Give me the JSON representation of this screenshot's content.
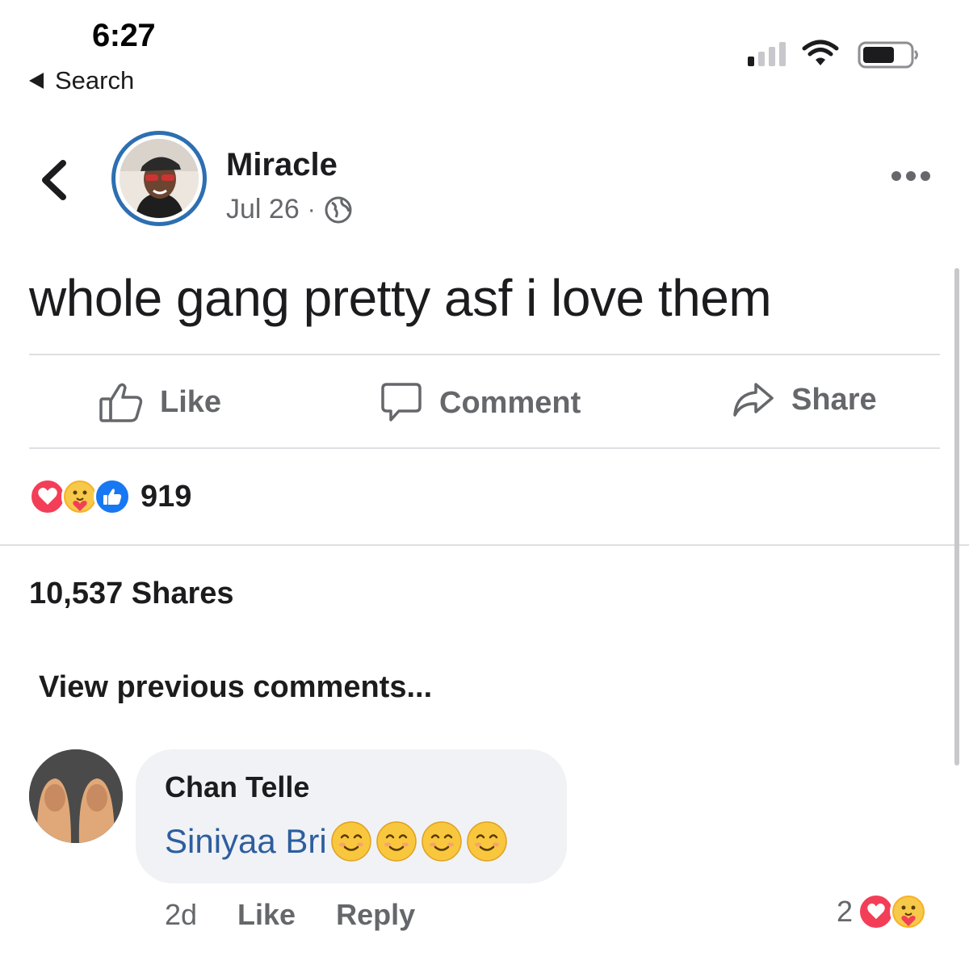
{
  "status_bar": {
    "time": "6:27",
    "back_label": "Search"
  },
  "post": {
    "author": "Miracle",
    "date": "Jul 26",
    "meta_separator": "·",
    "privacy_icon": "globe-icon",
    "text": "whole gang pretty asf i love them"
  },
  "actions": {
    "like": "Like",
    "comment": "Comment",
    "share": "Share"
  },
  "reactions": {
    "types": [
      "love",
      "care",
      "like"
    ],
    "count": "919"
  },
  "shares_text": "10,537 Shares",
  "view_previous": "View previous comments...",
  "comment": {
    "author": "Chan Telle",
    "mention": "Siniyaa Bri",
    "emoji_count": 4,
    "time": "2d",
    "like": "Like",
    "reply": "Reply",
    "reaction_count": "2",
    "reaction_types": [
      "love",
      "care"
    ]
  },
  "colors": {
    "accent": "#1877f2",
    "love": "#f33e58",
    "care": "#f7b125",
    "mention": "#2d5e9e",
    "muted": "#65676b"
  }
}
